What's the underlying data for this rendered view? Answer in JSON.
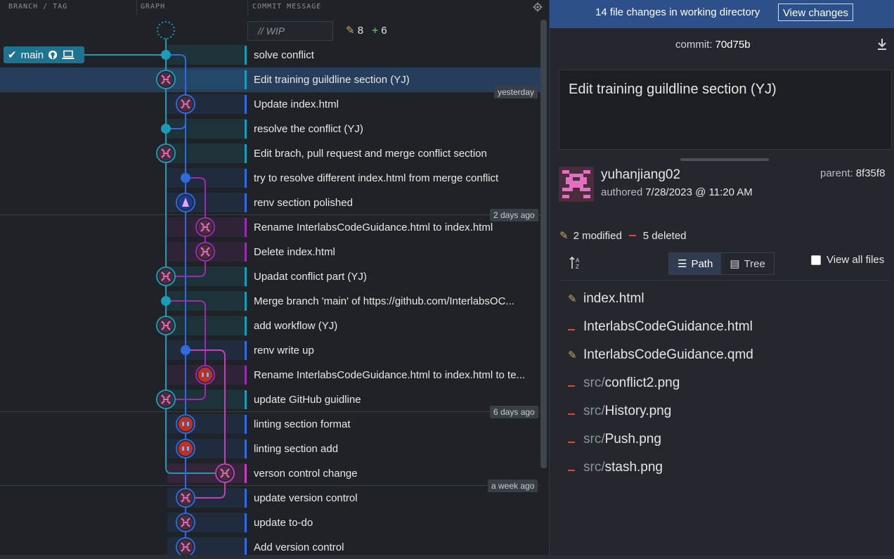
{
  "header": {
    "col_branch": "BRANCH / TAG",
    "col_graph": "GRAPH",
    "col_message": "COMMIT MESSAGE"
  },
  "wip": {
    "placeholder": "// WIP",
    "modified": "8",
    "added": "6"
  },
  "branches": [
    {
      "label": "main",
      "type": "local-active"
    },
    {
      "label": "main",
      "type": "remote"
    }
  ],
  "time_markers": [
    "yesterday",
    "2 days ago",
    "6 days ago",
    "a week ago"
  ],
  "commits": [
    {
      "message": "solve conflict",
      "lane_color": "#1c9bb8"
    },
    {
      "message": "Edit training guildline section (YJ)",
      "lane_color": "#1c9bb8"
    },
    {
      "message": "Update index.html",
      "lane_color": "#2f6bdc"
    },
    {
      "message": "resolve the conflict (YJ)",
      "lane_color": "#1c9bb8"
    },
    {
      "message": "Edit brach, pull request and merge conflict section",
      "lane_color": "#1c9bb8"
    },
    {
      "message": "try to resolve different index.html from merge conflict",
      "lane_color": "#2f6bdc"
    },
    {
      "message": "renv section polished",
      "lane_color": "#2f6bdc"
    },
    {
      "message": "Rename InterlabsCodeGuidance.html to index.html",
      "lane_color": "#9c2bb0"
    },
    {
      "message": "Delete index.html",
      "lane_color": "#9c2bb0"
    },
    {
      "message": "Upadat conflict part (YJ)",
      "lane_color": "#1c9bb8"
    },
    {
      "message": "Merge branch 'main' of https://github.com/InterlabsOC...",
      "lane_color": "#1c9bb8"
    },
    {
      "message": "add workflow (YJ)",
      "lane_color": "#1c9bb8"
    },
    {
      "message": "renv write up",
      "lane_color": "#2f6bdc"
    },
    {
      "message": "Rename InterlabsCodeGuidance.html to index.html to te...",
      "lane_color": "#9c2bb0"
    },
    {
      "message": "update GitHub guidline",
      "lane_color": "#1c9bb8"
    },
    {
      "message": "linting section format",
      "lane_color": "#2f6bdc"
    },
    {
      "message": "linting section add",
      "lane_color": "#2f6bdc"
    },
    {
      "message": "verson control change",
      "lane_color": "#c23fbd"
    },
    {
      "message": "update version control",
      "lane_color": "#2f6bdc"
    },
    {
      "message": "update to-do",
      "lane_color": "#2f6bdc"
    },
    {
      "message": "Add version control",
      "lane_color": "#2f6bdc"
    }
  ],
  "right": {
    "banner_text": "14 file changes in working directory",
    "view_changes": "View changes",
    "commit_label": "commit:",
    "commit_sha": "70d75b",
    "commit_message": "Edit training guildline section (YJ)",
    "author": "yuhanjiang02",
    "authored_label": "authored",
    "authored_date": "7/28/2023 @ 11:20 AM",
    "parent_label": "parent:",
    "parent_sha": "8f35f8",
    "modified_count": "2 modified",
    "deleted_count": "5 deleted",
    "view_path": "Path",
    "view_tree": "Tree",
    "view_all_files": "View all files",
    "files": [
      {
        "status": "modified",
        "dir": "",
        "name": "index.html"
      },
      {
        "status": "deleted",
        "dir": "",
        "name": "InterlabsCodeGuidance.html"
      },
      {
        "status": "modified",
        "dir": "",
        "name": "InterlabsCodeGuidance.qmd"
      },
      {
        "status": "deleted",
        "dir": "src/",
        "name": "conflict2.png"
      },
      {
        "status": "deleted",
        "dir": "src/",
        "name": "History.png"
      },
      {
        "status": "deleted",
        "dir": "src/",
        "name": "Push.png"
      },
      {
        "status": "deleted",
        "dir": "src/",
        "name": "stash.png"
      }
    ]
  }
}
